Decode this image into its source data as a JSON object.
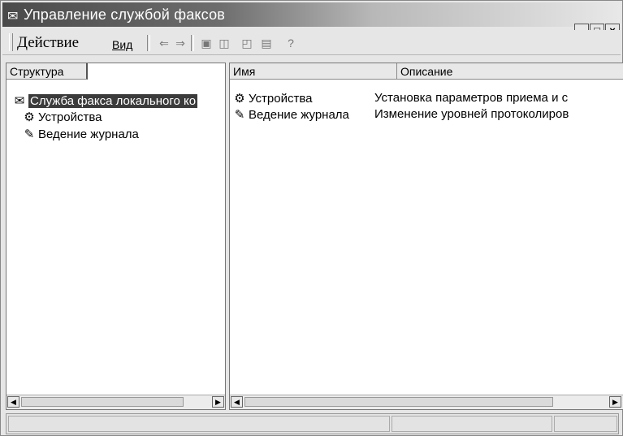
{
  "window": {
    "title": "Управление службой факсов",
    "icon": "fax-service-icon",
    "controls": {
      "minimize": "_",
      "maximize": "□",
      "close": "×"
    }
  },
  "menubar": {
    "items": [
      {
        "label": "Действие"
      },
      {
        "label": "Вид"
      }
    ],
    "toolbar": [
      "back-icon",
      "forward-icon",
      "up-icon",
      "show-tree-icon",
      "properties-icon",
      "export-icon",
      "help-icon"
    ]
  },
  "left_pane": {
    "tab_label": "Структура",
    "tree": [
      {
        "label": "Служба факса локального ко",
        "icon": "fax-service-icon",
        "selected": true
      },
      {
        "label": "Устройства",
        "icon": "devices-icon"
      },
      {
        "label": "Ведение журнала",
        "icon": "logging-icon"
      }
    ]
  },
  "right_pane": {
    "columns": [
      "Имя",
      "Описание"
    ],
    "rows": [
      {
        "name": "Устройства",
        "description": "Установка параметров приема и с",
        "icon": "devices-icon"
      },
      {
        "name": "Ведение журнала",
        "description": "Изменение уровней протоколиров",
        "icon": "logging-icon"
      }
    ]
  }
}
